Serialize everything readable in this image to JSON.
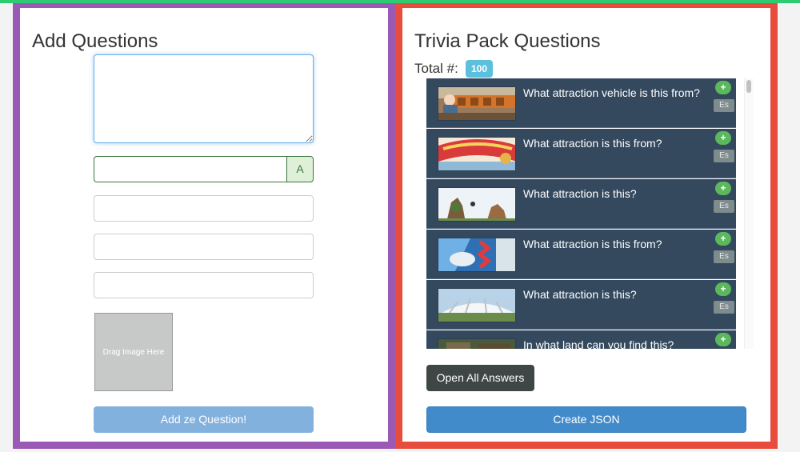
{
  "left_panel": {
    "title": "Add Questions",
    "question_value": "",
    "answer_value": "",
    "answer_addon": "A",
    "wrong_answers": [
      "",
      "",
      ""
    ],
    "dropzone_label": "Drag Image Here",
    "add_button": "Add ze Question!"
  },
  "right_panel": {
    "title": "Trivia Pack Questions",
    "total_label": "Total #:",
    "total_count": "100",
    "questions": [
      {
        "text": "What attraction vehicle is this from?",
        "plus": "+",
        "lang": "Es"
      },
      {
        "text": "What attraction is this from?",
        "plus": "+",
        "lang": "Es"
      },
      {
        "text": "What attraction is this?",
        "plus": "+",
        "lang": "Es"
      },
      {
        "text": "What attraction is this from?",
        "plus": "+",
        "lang": "Es"
      },
      {
        "text": "What attraction is this?",
        "plus": "+",
        "lang": "Es"
      },
      {
        "text": "In what land can you find this?",
        "plus": "+",
        "lang": ""
      }
    ],
    "open_answers_button": "Open All Answers",
    "create_json_button": "Create JSON"
  },
  "colors": {
    "left_border": "#9b59b6",
    "right_border": "#e74c3c",
    "top_strip": "#2ecc71",
    "row_bg": "#34495e",
    "badge": "#5bc0de",
    "primary": "#428bca"
  }
}
